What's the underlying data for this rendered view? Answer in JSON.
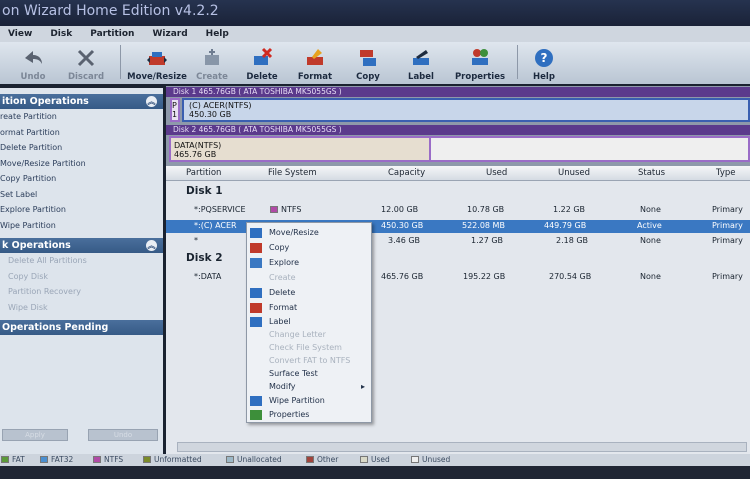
{
  "window": {
    "title": "on Wizard Home Edition v4.2.2"
  },
  "menu": [
    "View",
    "Disk",
    "Partition",
    "Wizard",
    "Help"
  ],
  "toolbar": {
    "undo": "Undo",
    "discard": "Discard",
    "move_resize": "Move/Resize",
    "create": "Create",
    "delete": "Delete",
    "format": "Format",
    "copy": "Copy",
    "label": "Label",
    "properties": "Properties",
    "help": "Help"
  },
  "left": {
    "partition_ops_title": "ition Operations",
    "partition_ops": [
      "reate Partition",
      "ormat Partition",
      "Delete Partition",
      "Move/Resize Partition",
      "Copy Partition",
      "Set Label",
      "Explore Partition",
      "Wipe Partition"
    ],
    "disk_ops_title": "k Operations",
    "disk_ops": [
      "Delete All Partitions",
      "Copy Disk",
      "Partition Recovery",
      "Wipe Disk"
    ],
    "pending_title": "Operations Pending",
    "apply": "Apply",
    "undo": "Undo"
  },
  "diskmap": {
    "disk1_header": "Disk 1 465.76GB  ( ATA TOSHIBA MK5055GS )",
    "disk1_part_name": "(C) ACER(NTFS)",
    "disk1_part_size": "450.30 GB",
    "disk1_small_a": "P",
    "disk1_small_b": "1",
    "disk2_header": "Disk 2 465.76GB  ( ATA TOSHIBA MK5055GS )",
    "disk2_part_name": "DATA(NTFS)",
    "disk2_part_size": "465.76 GB"
  },
  "table": {
    "headers": [
      "Partition",
      "File System",
      "Capacity",
      "Used",
      "Unused",
      "Status",
      "Type"
    ],
    "disk1_label": "Disk 1",
    "disk2_label": "Disk 2",
    "rows": [
      {
        "partition": "*:PQSERVICE",
        "fs": "NTFS",
        "capacity": "12.00 GB",
        "used": "10.78 GB",
        "unused": "1.22 GB",
        "status": "None",
        "type": "Primary"
      },
      {
        "partition": "*:(C) ACER",
        "fs": "",
        "capacity": "450.30 GB",
        "used": "522.08 MB",
        "unused": "449.79 GB",
        "status": "Active",
        "type": "Primary"
      },
      {
        "partition": "*",
        "fs": "",
        "capacity": "3.46 GB",
        "used": "1.27 GB",
        "unused": "2.18 GB",
        "status": "None",
        "type": "Primary"
      },
      {
        "partition": "*:DATA",
        "fs": "",
        "capacity": "465.76 GB",
        "used": "195.22 GB",
        "unused": "270.54 GB",
        "status": "None",
        "type": "Primary"
      }
    ]
  },
  "context_menu": {
    "items": [
      "Move/Resize",
      "Copy",
      "Explore",
      "Create",
      "Delete",
      "Format",
      "Label",
      "Change Letter",
      "Check File System",
      "Convert FAT to NTFS",
      "Surface Test",
      "Modify",
      "Wipe Partition",
      "Properties"
    ],
    "modify_arrow": "▸"
  },
  "legend": [
    "FAT",
    "FAT32",
    "NTFS",
    "Unformatted",
    "Unallocated",
    "Other",
    "Used",
    "Unused"
  ],
  "colors": {
    "ntfs": "#b04aa6",
    "fat": "#5c9a3a",
    "fat32": "#4b8fd0",
    "unformatted": "#7b8b2a",
    "unallocated": "#9cb8c7",
    "other": "#a0443c",
    "used": "#d9d9c8",
    "unused": "#efefef"
  }
}
